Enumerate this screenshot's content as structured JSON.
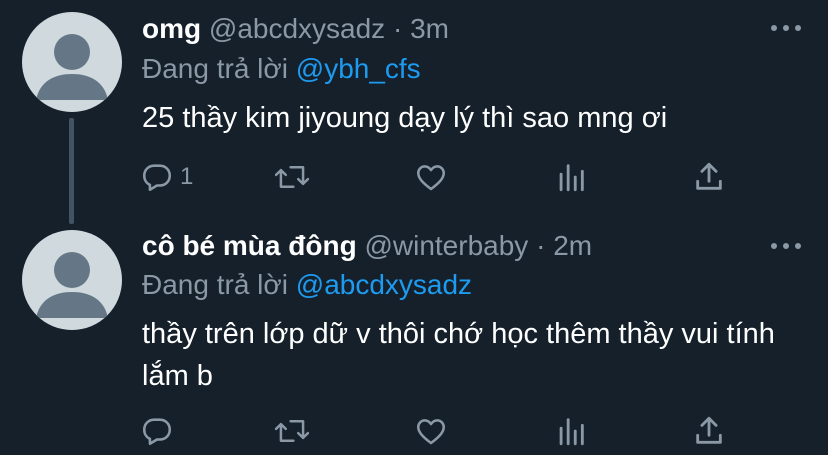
{
  "tweets": [
    {
      "name": "omg",
      "handle": "@abcdxysadz",
      "separator": "·",
      "time": "3m",
      "reply_prefix": "Đang trả lời",
      "reply_to": "@ybh_cfs",
      "text": "25 thầy kim jiyoung dạy lý thì sao mng ơi",
      "reply_count": "1"
    },
    {
      "name": "cô bé mùa đông",
      "handle": "@winterbaby",
      "separator": "·",
      "time": "2m",
      "reply_prefix": "Đang trả lời",
      "reply_to": "@abcdxysadz",
      "text": "thầy trên lớp dữ v thôi chớ học thêm thầy vui tính lắm b",
      "reply_count": ""
    }
  ],
  "icons": [
    "more-icon",
    "reply-icon",
    "retweet-icon",
    "like-icon",
    "analytics-icon",
    "share-icon"
  ],
  "colors": {
    "background": "#15202b",
    "muted": "#8b98a5",
    "link": "#1d9bf0",
    "thread_line": "#425364",
    "avatar_bg": "#cfd9de",
    "avatar_fg": "#657786"
  }
}
